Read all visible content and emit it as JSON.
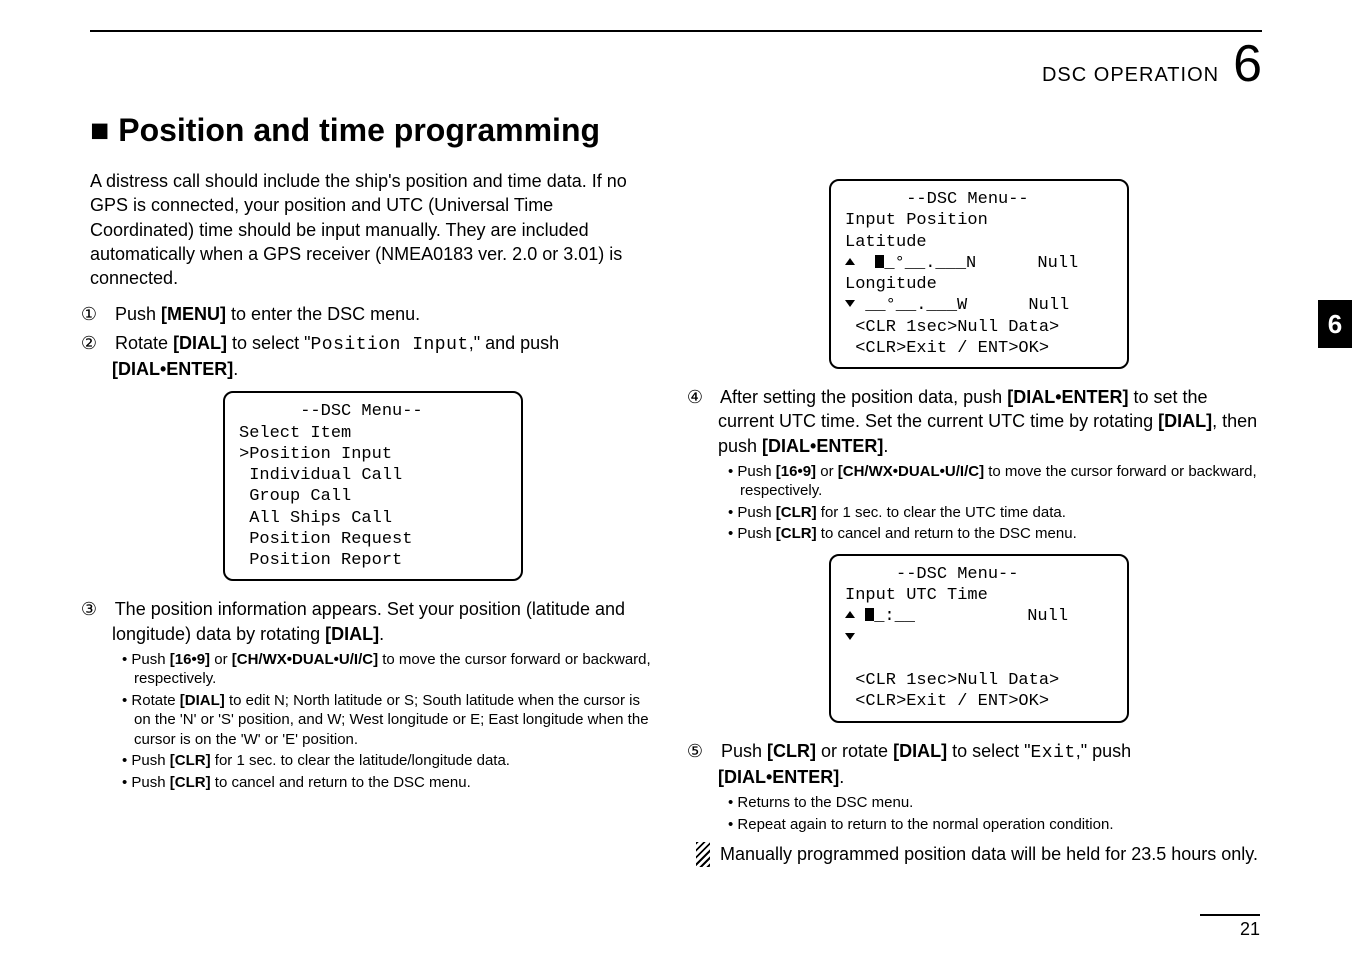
{
  "header": {
    "chapter_label": "DSC OPERATION",
    "chapter_num": "6"
  },
  "section_title": "■ Position and time programming",
  "side_tab": "6",
  "page_num": "21",
  "left": {
    "intro": "A distress call should include the ship's position and time data. If no GPS is connected, your position and UTC (Universal Time Coordinated) time should be input manually. They are included automatically when a GPS receiver (NMEA0183 ver. 2.0 or 3.01) is connected.",
    "step1": {
      "circ": "①",
      "a": "Push ",
      "b": "[MENU]",
      "c": " to enter the DSC menu."
    },
    "step2": {
      "circ": "②",
      "a": "Rotate ",
      "b": "[DIAL]",
      "c": " to select \"",
      "d": "Position Input",
      "e": ",\" and push ",
      "f": "[DIAL•ENTER]",
      "g": "."
    },
    "lcd1": {
      "l1": "      --DSC Menu--",
      "l2": "Select Item",
      "l3": "˃Position Input",
      "l4": " Individual Call",
      "l5": " Group Call",
      "l6": " All Ships Call",
      "l7": " Position Request",
      "l8": " Position Report"
    },
    "step3": {
      "circ": "③",
      "a": "The position information appears. Set your position (latitude and longitude) data by rotating ",
      "b": "[DIAL]",
      "c": "."
    },
    "b1": {
      "a": "• Push ",
      "b": "[16•9]",
      "c": " or ",
      "d": "[CH/WX•DUAL•U/I/C]",
      "e": " to move the cursor forward or backward, respectively."
    },
    "b2": {
      "a": "• Rotate ",
      "b": "[DIAL]",
      "c": " to edit N; North latitude or S; South latitude when the cursor is on the 'N' or 'S' position, and W; West longitude or E; East longitude when the cursor is on the 'W' or 'E' position."
    },
    "b3": {
      "a": "• Push ",
      "b": "[CLR]",
      "c": " for 1 sec. to clear the latitude/longitude data."
    },
    "b4": {
      "a": "• Push ",
      "b": "[CLR]",
      "c": " to cancel and return to the DSC menu."
    }
  },
  "right": {
    "lcd2": {
      "l1": "      --DSC Menu--",
      "l2": "Input Position",
      "l3_a": "Latitude",
      "l4_a": "  ",
      "l4_b": "_°__.___N      Null",
      "l5": "Longitude",
      "l6": " __°__.___W      Null",
      "l7": " <CLR 1sec˃Null Data>",
      "l8": " <CLR˃Exit / ENT˃OK>"
    },
    "step4": {
      "circ": "④",
      "a": "After setting the position data, push ",
      "b": "[DIAL•ENTER]",
      "c": " to set the current UTC time. Set the current UTC time by rotating ",
      "d": "[DIAL]",
      "e": ", then push ",
      "f": "[DIAL•ENTER]",
      "g": "."
    },
    "b1": {
      "a": "• Push ",
      "b": "[16•9]",
      "c": " or ",
      "d": "[CH/WX•DUAL•U/I/C]",
      "e": " to move the cursor forward or backward, respectively."
    },
    "b2": {
      "a": "• Push ",
      "b": "[CLR]",
      "c": " for 1 sec. to clear the UTC time data."
    },
    "b3": {
      "a": "• Push ",
      "b": "[CLR]",
      "c": " to cancel and return to the DSC menu."
    },
    "lcd3": {
      "l1": "     --DSC Menu--",
      "l2": "Input UTC Time",
      "l3_a": " ",
      "l3_b": "_:__           Null",
      "blank": "",
      "l6": " <CLR 1sec˃Null Data>",
      "l7": " <CLR˃Exit / ENT˃OK>"
    },
    "step5": {
      "circ": "⑤",
      "a": "Push ",
      "b": "[CLR]",
      "c": " or rotate ",
      "d": "[DIAL]",
      "e": " to select \"",
      "f": "Exit",
      "g": ",\" push ",
      "h": "[DIAL•ENTER]",
      "i": "."
    },
    "b4": {
      "a": "• Returns to the DSC menu."
    },
    "b5": {
      "a": "• Repeat again to return to the normal operation condition."
    },
    "note": "Manually programmed position data will be held for 23.5 hours only."
  }
}
